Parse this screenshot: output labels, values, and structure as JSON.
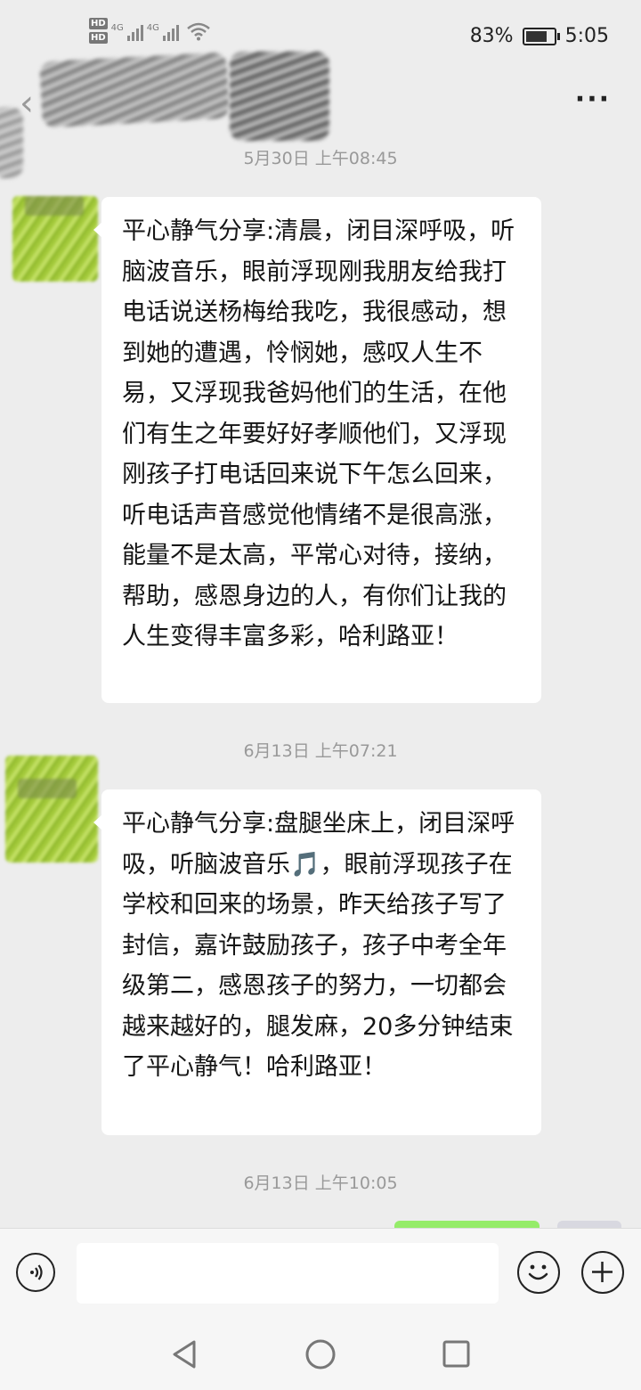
{
  "status_bar": {
    "hd_badge": "HD",
    "network_1": "4G",
    "network_2": "4G",
    "battery_percent": "83%",
    "battery_level": 0.83,
    "time": "5:05"
  },
  "nav": {
    "back_icon": "chevron-left-icon",
    "more_label": "···"
  },
  "messages": [
    {
      "time": "5月30日 上午08:45",
      "text": "平心静气分享:清晨，闭目深呼吸，听脑波音乐，眼前浮现刚我朋友给我打电话说送杨梅给我吃，我很感动，想到她的遭遇，怜悯她，感叹人生不易，又浮现我爸妈他们的生活，在他们有生之年要好好孝顺他们，又浮现刚孩子打电话回来说下午怎么回来，听电话声音感觉他情绪不是很高涨，能量不是太高，平常心对待，接纳，帮助，感恩身边的人，有你们让我的人生变得丰富多彩，哈利路亚！"
    },
    {
      "time": "6月13日 上午07:21",
      "text_before_icon": "平心静气分享:盘腿坐床上，闭目深呼吸，听脑波音乐",
      "icon": "🎵",
      "text_after_icon": "，眼前浮现孩子在学校和回来的场景，昨天给孩子写了封信，嘉许鼓励孩子，孩子中考全年级第二，感恩孩子的努力，一切都会越来越好的，腿发麻，20多分钟结束了平心静气！哈利路亚！"
    },
    {
      "time": "6月13日 上午10:05"
    }
  ],
  "input": {
    "placeholder": ""
  },
  "icons": {
    "voice": "voice-icon",
    "emoji": "emoji-icon",
    "plus": "plus-icon",
    "sys_back": "triangle-back-icon",
    "sys_home": "circle-home-icon",
    "sys_recent": "square-recent-icon"
  },
  "colors": {
    "background": "#ededed",
    "bubble": "#ffffff",
    "sent_bubble": "#95ec69",
    "timestamp": "#999999"
  }
}
